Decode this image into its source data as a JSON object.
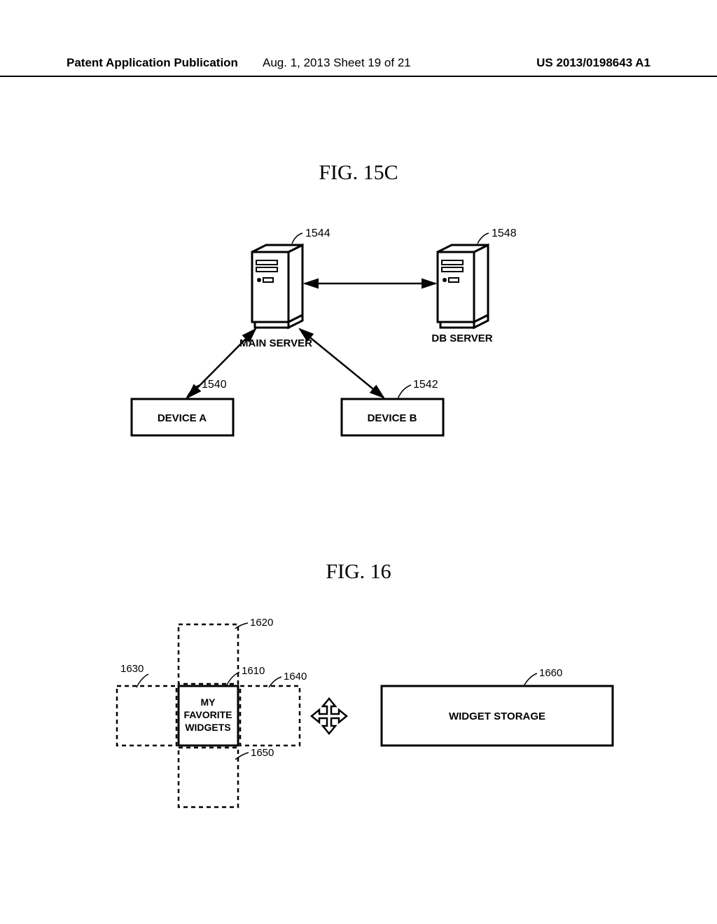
{
  "header": {
    "left": "Patent Application Publication",
    "center": "Aug. 1, 2013  Sheet 19 of 21",
    "right": "US 2013/0198643 A1"
  },
  "fig15c": {
    "title": "FIG.  15C",
    "main_server": "MAIN SERVER",
    "db_server": "DB SERVER",
    "device_a": "DEVICE A",
    "device_b": "DEVICE B",
    "ref_main": "1544",
    "ref_db": "1548",
    "ref_a": "1540",
    "ref_b": "1542"
  },
  "fig16": {
    "title": "FIG.  16",
    "center_line1": "MY",
    "center_line2": "FAVORITE",
    "center_line3": "WIDGETS",
    "storage": "WIDGET STORAGE",
    "ref_top": "1620",
    "ref_center": "1610",
    "ref_left": "1630",
    "ref_right": "1640",
    "ref_bottom": "1650",
    "ref_storage": "1660"
  }
}
